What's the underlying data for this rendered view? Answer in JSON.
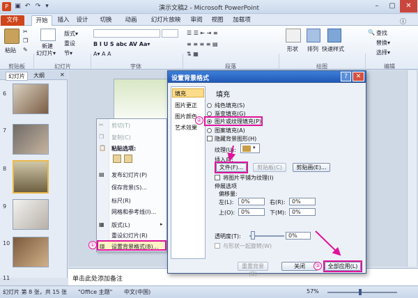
{
  "window": {
    "title": "演示文稿2 - Microsoft PowerPoint"
  },
  "tabs": [
    "文件",
    "开始",
    "插入",
    "设计",
    "切换",
    "动画",
    "幻灯片放映",
    "审阅",
    "视图",
    "加载项"
  ],
  "ribbon": {
    "paste": "粘贴",
    "clipboard": "剪贴板",
    "new_slide": "新建",
    "new_slide2": "幻灯片▾",
    "slides_group": "幻灯片",
    "layout": "版式▾",
    "reset": "重设",
    "section": "节▾",
    "font_group": "字体",
    "paragraph_group": "段落",
    "drawing_group": "绘图",
    "editing_group": "编辑",
    "shapes": "形状",
    "arrange": "排列",
    "quick_styles": "快速样式",
    "find": "查找",
    "replace": "替换▾",
    "select": "选择▾"
  },
  "left_pane": {
    "tab_slides": "幻灯片",
    "tab_outline": "大纲",
    "slide_numbers": [
      "6",
      "7",
      "8",
      "9",
      "10",
      "11"
    ]
  },
  "context_menu": {
    "items": [
      "剪切(T)",
      "复制(C)",
      "粘贴选项:",
      "发布幻灯片(P)",
      "保存背景(S)...",
      "标尺(R)",
      "网格和参考线(I)...",
      "版式(L)",
      "重设幻灯片(R)",
      "设置背景格式(B)..."
    ],
    "marker": "①"
  },
  "dialog": {
    "title": "设置背景格式",
    "help": "?",
    "close": "✕",
    "nav": [
      "填充",
      "图片更正",
      "图片颜色",
      "艺术效果"
    ],
    "heading": "填充",
    "options": [
      "纯色填充(S)",
      "渐变填充(G)",
      "图片或纹理填充(P)",
      "图案填充(A)"
    ],
    "hide_bg": "隐藏背景图形(H)",
    "texture_label": "纹理(U):",
    "insert_from": "插入自:",
    "file_btn": "文件(F)...",
    "clipboard_btn": "剪贴板(C)",
    "clipart_btn": "剪贴画(E)...",
    "tile": "将图片平铺为纹理(I)",
    "stretch": "伸展选项",
    "offsets": "偏移量:",
    "left": "左(L):",
    "right": "右(R):",
    "top": "上(O):",
    "bottom": "下(M):",
    "left_val": "0%",
    "right_val": "0%",
    "top_val": "0%",
    "bottom_val": "0%",
    "transparency": "透明度(T):",
    "transparency_val": "0%",
    "rotate": "与形状一起旋转(W)",
    "reset_btn": "重置背景(B)",
    "close_btn": "关闭",
    "apply_all": "全部应用(L)",
    "marker2": "②",
    "marker3": "③"
  },
  "notes": {
    "placeholder": "单击此处添加备注"
  },
  "status": {
    "slide": "幻灯片 第 8 张，共 15 张",
    "theme": "\"Office 主题\"",
    "lang": "中文(中国)",
    "zoom": "57%"
  }
}
